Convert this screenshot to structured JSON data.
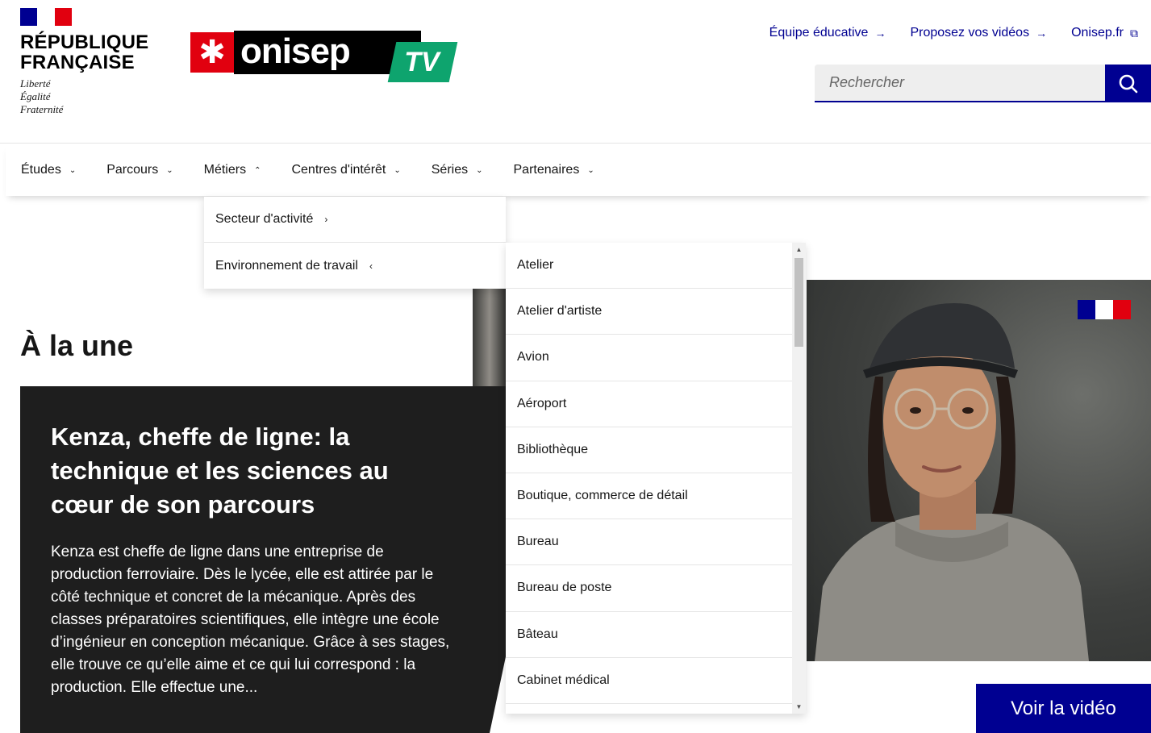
{
  "header": {
    "republique": {
      "line1": "RÉPUBLIQUE",
      "line2": "FRANÇAISE",
      "motto1": "Liberté",
      "motto2": "Égalité",
      "motto3": "Fraternité"
    },
    "brand": {
      "symbol": "✱",
      "name": "onisep",
      "suffix": "TV",
      "colors": {
        "red": "#e1000f",
        "black": "#000000",
        "green": "#0ea46e"
      }
    },
    "quick_links": [
      {
        "label": "Équipe éducative",
        "icon": "arrow-right-icon",
        "glyph": "→"
      },
      {
        "label": "Proposez vos vidéos",
        "icon": "arrow-right-icon",
        "glyph": "→"
      },
      {
        "label": "Onisep.fr",
        "icon": "external-link-icon",
        "glyph": "⧉"
      }
    ],
    "search": {
      "placeholder": "Rechercher",
      "icon": "search-icon"
    }
  },
  "nav": {
    "items": [
      {
        "label": "Études",
        "chevron": "⌄",
        "expanded": false
      },
      {
        "label": "Parcours",
        "chevron": "⌄",
        "expanded": false
      },
      {
        "label": "Métiers",
        "chevron": "⌃",
        "expanded": true
      },
      {
        "label": "Centres d'intérêt",
        "chevron": "⌄",
        "expanded": false
      },
      {
        "label": "Séries",
        "chevron": "⌄",
        "expanded": false
      },
      {
        "label": "Partenaires",
        "chevron": "⌄",
        "expanded": false
      }
    ]
  },
  "metiers_menu": {
    "items": [
      {
        "label": "Secteur d'activité",
        "chevron": "›"
      },
      {
        "label": "Environnement de travail",
        "chevron": "‹"
      }
    ]
  },
  "environnement_menu": {
    "items": [
      "Atelier",
      "Atelier d'artiste",
      "Avion",
      "Aéroport",
      "Bibliothèque",
      "Boutique, commerce de détail",
      "Bureau",
      "Bureau de poste",
      "Bâteau",
      "Cabinet médical"
    ]
  },
  "main": {
    "section_title": "À la une",
    "feature": {
      "title": "Kenza, cheffe de ligne: la technique et les sciences au cœur de son parcours",
      "summary": "Kenza est cheffe de ligne dans une entreprise de production ferroviaire. Dès le lycée, elle est attirée par le côté technique et concret de la mécanique.  Après des classes préparatoires scientifiques, elle intègre une école d’ingénieur en conception mécanique. Grâce à ses stages, elle trouve ce qu’elle aime et ce qui lui correspond : la production. Elle effectue une..."
    },
    "cta": {
      "label": "Voir la vidéo"
    }
  },
  "colors": {
    "primary_blue": "#000091",
    "feature_bg": "#1e1e1e",
    "marianne_blue": "#000091",
    "marianne_red": "#e1000f"
  }
}
